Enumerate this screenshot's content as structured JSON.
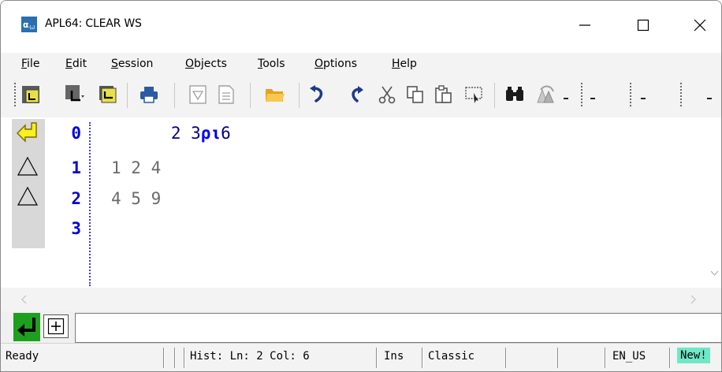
{
  "window": {
    "title": "APL64: CLEAR WS",
    "minimize_glyph": "—",
    "maximize_glyph": "☐",
    "close_glyph": "✕"
  },
  "menu": {
    "items": [
      {
        "key": "F",
        "rest": "ile"
      },
      {
        "key": "E",
        "rest": "dit"
      },
      {
        "key": "S",
        "rest": "ession"
      },
      {
        "key": "O",
        "rest": "bjects"
      },
      {
        "key": "T",
        "rest": "ools"
      },
      {
        "key": "O",
        "rest": "ptions"
      },
      {
        "key": "H",
        "rest": "elp"
      }
    ]
  },
  "toolbar": {
    "icons": [
      "new-session-icon",
      "object-icon",
      "copy-window-icon",
      "print-icon",
      "filter-icon",
      "document-icon",
      "open-folder-icon",
      "undo-icon",
      "redo-icon",
      "cut-icon",
      "copy-icon",
      "paste-icon",
      "screen-capture-icon",
      "find-icon",
      "find-next-icon"
    ]
  },
  "session": {
    "lines": [
      {
        "num": "0",
        "marker": "input-arrow",
        "text": "      2 3ριό"
      },
      {
        "num": "1",
        "marker": "triangle",
        "text": "1 2 4"
      },
      {
        "num": "2",
        "marker": "triangle",
        "text": "4 5 9"
      },
      {
        "num": "3",
        "marker": "",
        "text": ""
      }
    ],
    "input_line": "      2 3",
    "input_glyphs": "ρι",
    "input_tail": "6"
  },
  "status": {
    "ready": "Ready",
    "hist": "Hist: Ln: 2 Col: 6",
    "mode": "Ins",
    "keyboard": "Classic",
    "locale": "EN_US",
    "new": "New!"
  },
  "colors": {
    "line_number": "#0000d8",
    "gutter": "#d8d8d8",
    "enter_button": "#1ea01e",
    "new_badge": "#6ee8c6"
  }
}
